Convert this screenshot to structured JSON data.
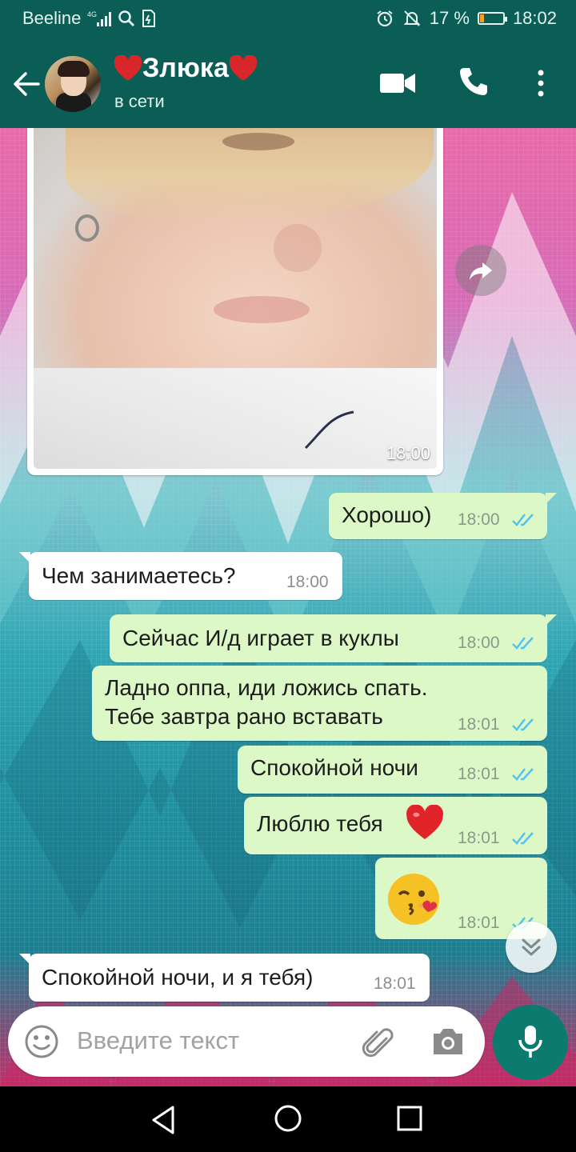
{
  "status_bar": {
    "carrier": "Beeline",
    "network": "4G",
    "battery_percent": "17 %",
    "battery_level": 0.17,
    "time": "18:02",
    "icons": [
      "signal-icon",
      "search-icon",
      "sim-icon",
      "alarm-icon",
      "mute-icon",
      "battery-icon"
    ]
  },
  "header": {
    "contact_name": "Злюка",
    "name_decoration": "heart-emoji",
    "status": "в сети",
    "icons": [
      "back-arrow-icon",
      "video-call-icon",
      "phone-icon",
      "more-vert-icon"
    ]
  },
  "messages": [
    {
      "type": "photo",
      "direction": "in",
      "time": "18:00"
    },
    {
      "type": "text",
      "direction": "out",
      "text": "Хорошо)",
      "time": "18:00",
      "read": true
    },
    {
      "type": "text",
      "direction": "in",
      "text": "Чем занимаетесь?",
      "time": "18:00"
    },
    {
      "type": "text",
      "direction": "out",
      "text": "Сейчас И/д играет в куклы",
      "time": "18:00",
      "read": true
    },
    {
      "type": "text",
      "direction": "out",
      "lines": [
        "Ладно оппа, иди ложись спать.",
        "Тебе завтра рано вставать"
      ],
      "time": "18:01",
      "read": true
    },
    {
      "type": "text",
      "direction": "out",
      "text": "Спокойной ночи",
      "time": "18:01",
      "read": true
    },
    {
      "type": "text",
      "direction": "out",
      "text": "Люблю тебя",
      "emoji": "red-heart",
      "time": "18:01",
      "read": true
    },
    {
      "type": "emoji",
      "direction": "out",
      "emoji": "kissing-face-with-heart",
      "time": "18:01",
      "read": true
    },
    {
      "type": "text",
      "direction": "in",
      "text": "Спокойной ночи, и я тебя)",
      "time": "18:01"
    }
  ],
  "composer": {
    "placeholder": "Введите текст",
    "icons": [
      "emoji-icon",
      "attach-icon",
      "camera-icon",
      "mic-icon"
    ]
  },
  "colors": {
    "header_bg": "#0a5e55",
    "outgoing_bubble": "#dcf8c6",
    "incoming_bubble": "#ffffff",
    "read_ticks": "#4fc3f7",
    "mic_button": "#0a7b6e"
  }
}
